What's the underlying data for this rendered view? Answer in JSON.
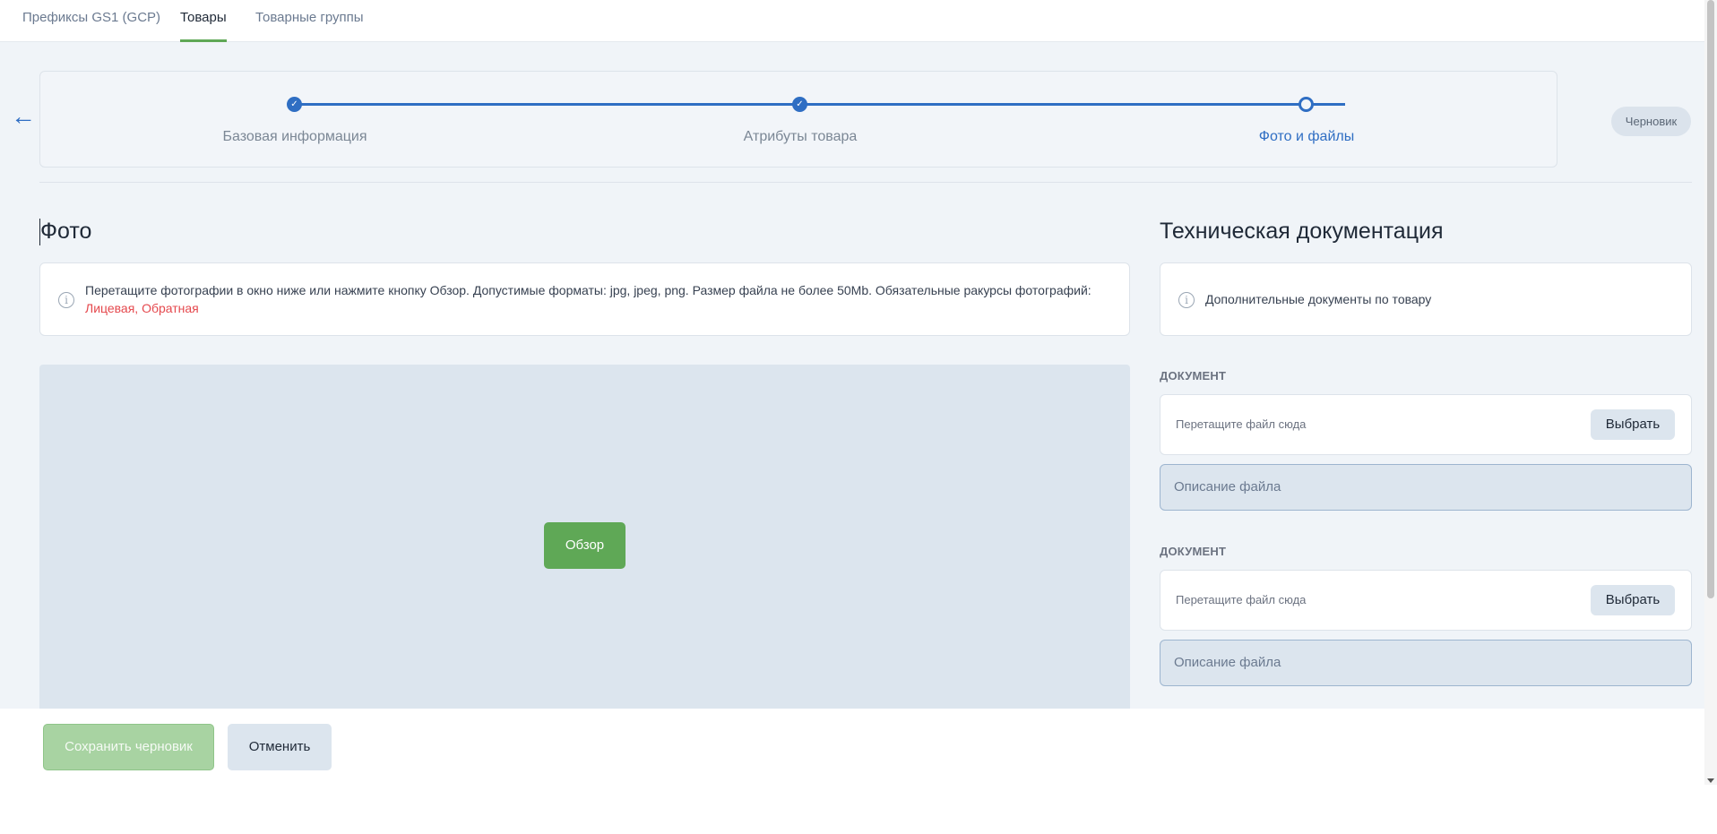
{
  "nav": {
    "tabs": [
      {
        "label": "Префиксы GS1 (GCP)",
        "active": false
      },
      {
        "label": "Товары",
        "active": true
      },
      {
        "label": "Товарные группы",
        "active": false
      }
    ]
  },
  "back_icon": "arrow-left-icon",
  "stepper": {
    "steps": [
      {
        "label": "Базовая информация",
        "state": "done"
      },
      {
        "label": "Атрибуты товара",
        "state": "done"
      },
      {
        "label": "Фото и файлы",
        "state": "current"
      }
    ],
    "check_glyph": "✓"
  },
  "status_badge": "Черновик",
  "photo": {
    "title": "Фото",
    "info_text": "Перетащите фотографии в окно ниже или нажмите кнопку Обзор. Допустимые форматы: jpg, jpeg, png. Размер файла не более 50Mb. Обязательные ракурсы фотографий:",
    "required_angles": "Лицевая, Обратная",
    "browse_label": "Обзор"
  },
  "tech_docs": {
    "title": "Техническая документация",
    "info_text": "Дополнительные документы по товару",
    "documents": [
      {
        "title": "ДОКУМЕНТ",
        "drop_hint": "Перетащите файл сюда",
        "pick_label": "Выбрать",
        "desc_placeholder": "Описание файла"
      },
      {
        "title": "ДОКУМЕНТ",
        "drop_hint": "Перетащите файл сюда",
        "pick_label": "Выбрать",
        "desc_placeholder": "Описание файла"
      }
    ]
  },
  "footer": {
    "save_label": "Сохранить черновик",
    "cancel_label": "Отменить"
  },
  "colors": {
    "accent_blue": "#2f6ec3",
    "accent_green": "#5fa856",
    "warning_red": "#e5484d"
  }
}
